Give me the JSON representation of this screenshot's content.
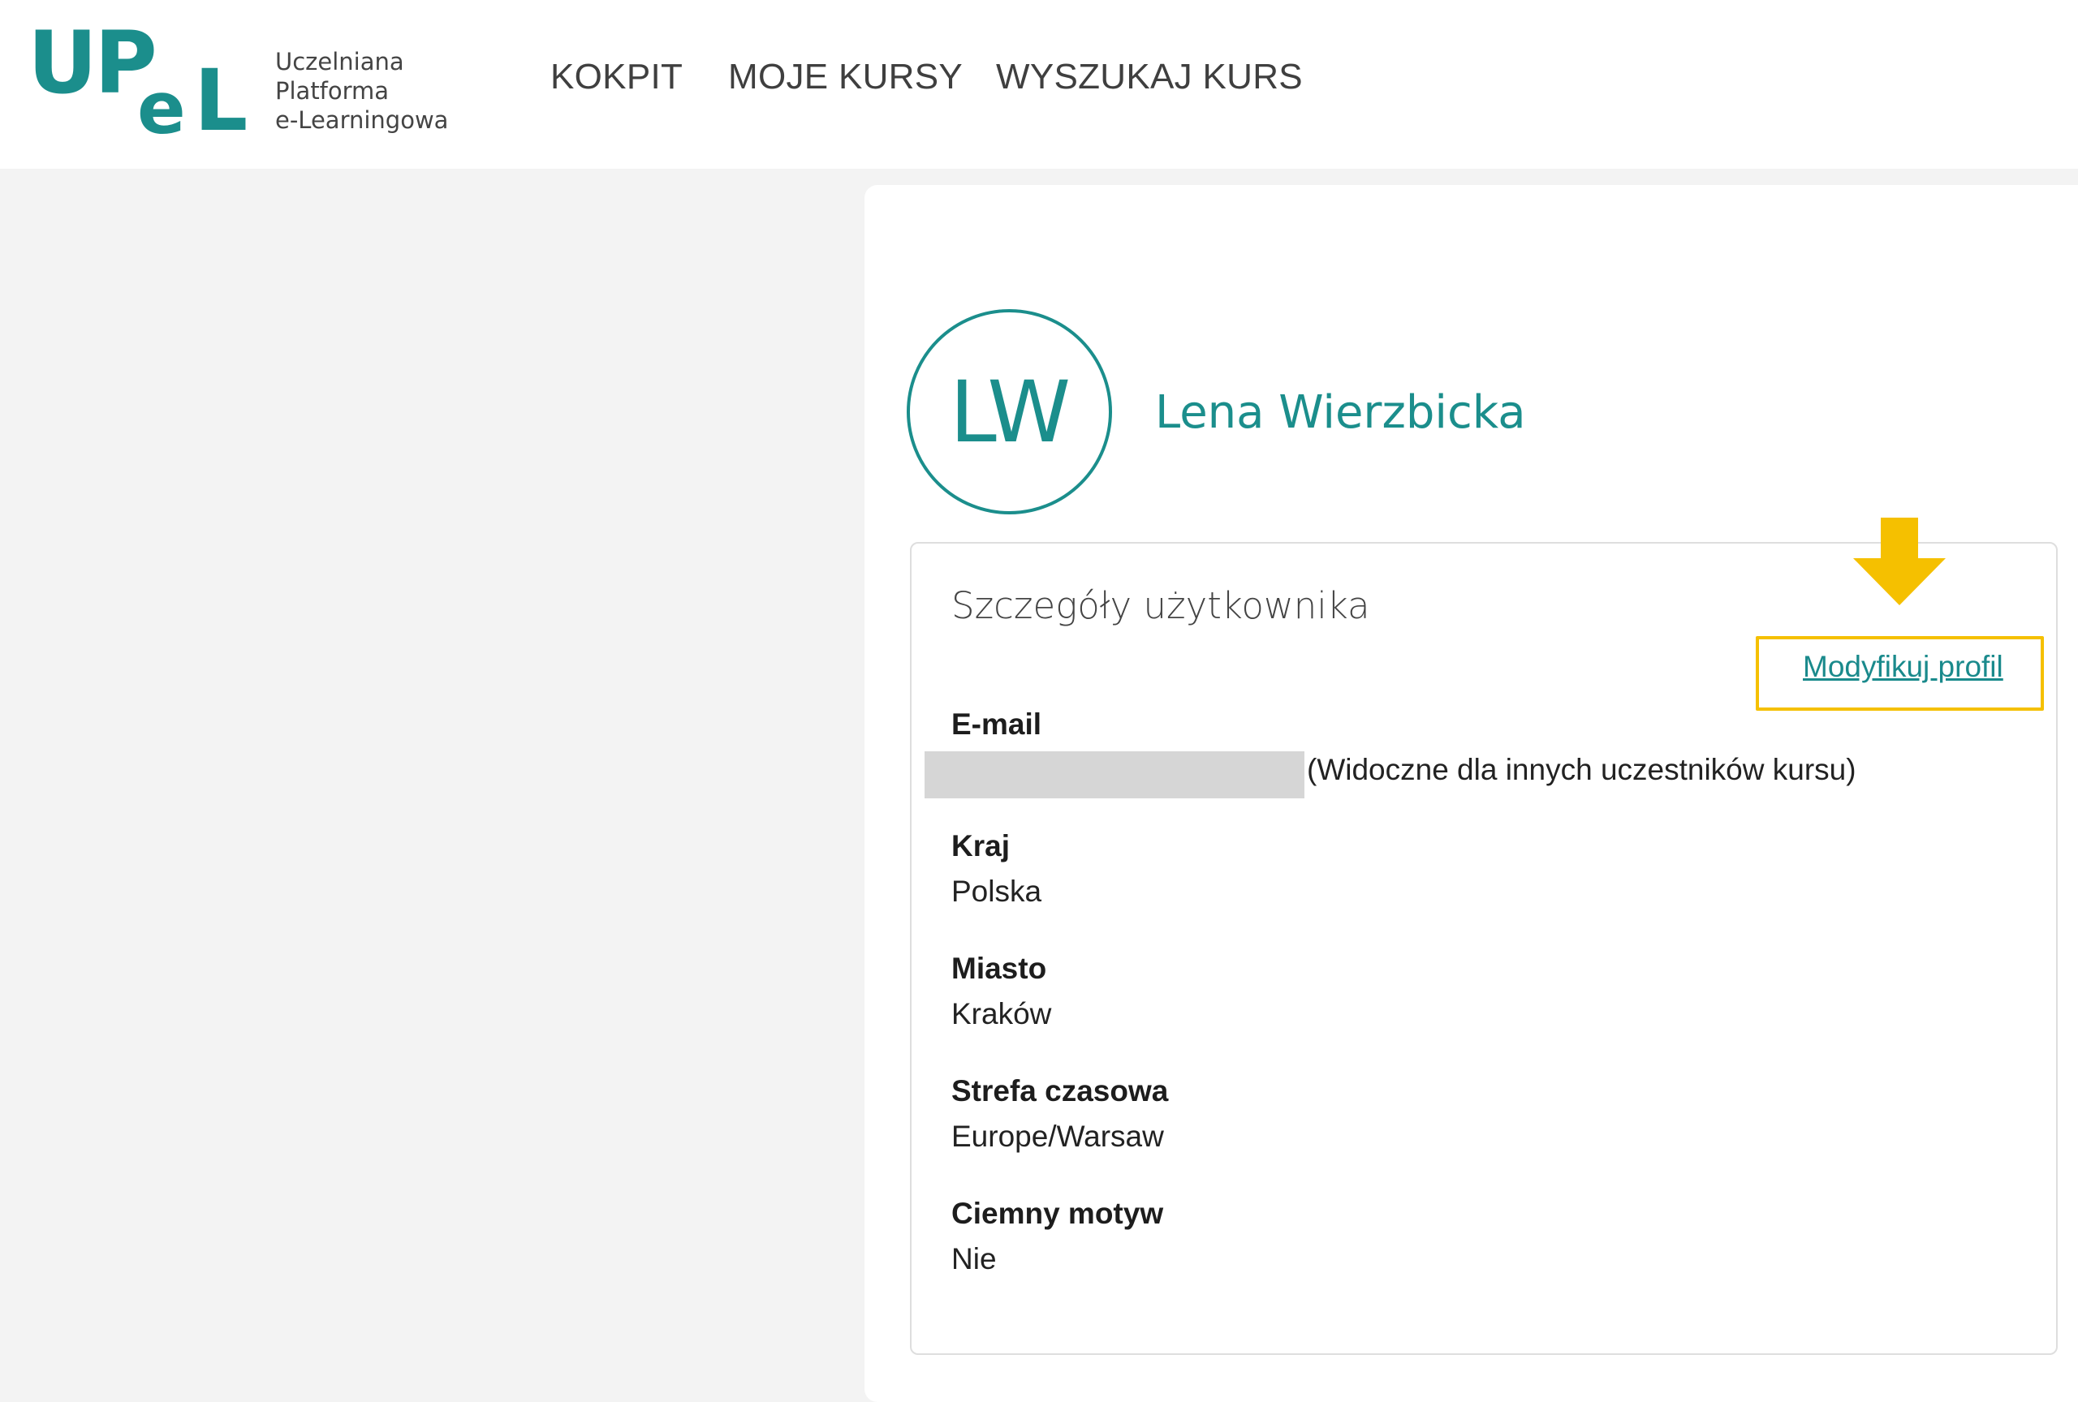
{
  "header": {
    "logo_letters": "UPeL",
    "logo_lines": [
      "Uczelniana",
      "Platforma",
      "e-Learningowa"
    ],
    "nav": [
      {
        "label": "KOKPIT"
      },
      {
        "label": "MOJE KURSY"
      },
      {
        "label": "WYSZUKAJ KURS"
      }
    ]
  },
  "profile": {
    "initials": "LW",
    "name": "Lena Wierzbicka"
  },
  "details": {
    "title": "Szczegóły użytkownika",
    "edit_link": "Modyfikuj profil",
    "email": {
      "label": "E-mail",
      "note": "(Widoczne dla innych uczestników kursu)"
    },
    "fields": [
      {
        "label": "Kraj",
        "value": "Polska"
      },
      {
        "label": "Miasto",
        "value": "Kraków"
      },
      {
        "label": "Strefa czasowa",
        "value": "Europe/Warsaw"
      },
      {
        "label": "Ciemny motyw",
        "value": "Nie"
      }
    ]
  },
  "colors": {
    "brand": "#1b8e8c",
    "highlight": "#f5c000",
    "background": "#f3f3f3"
  }
}
